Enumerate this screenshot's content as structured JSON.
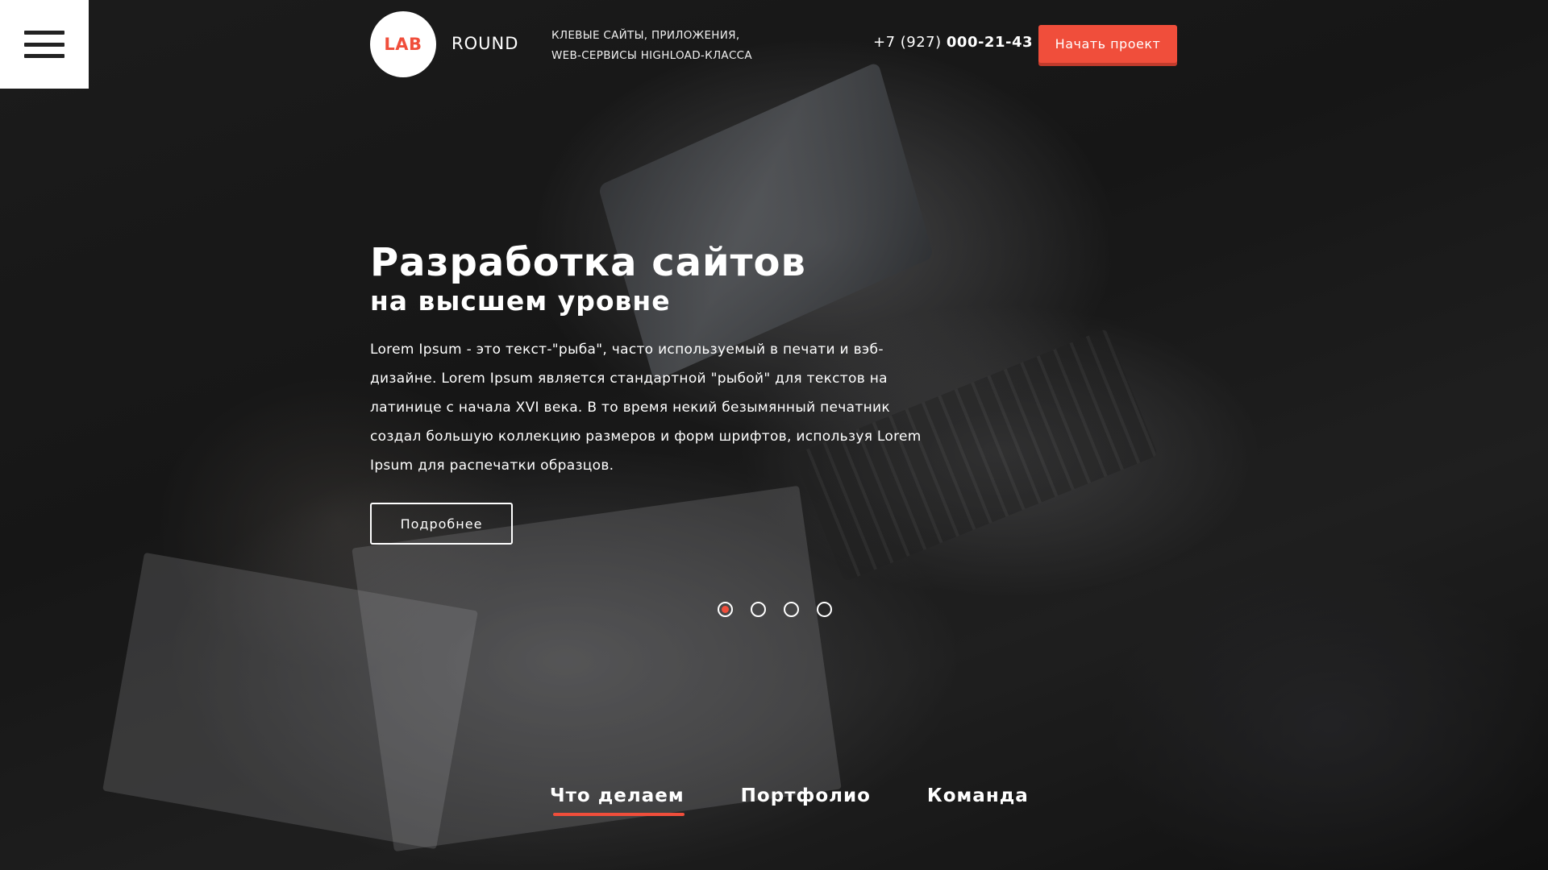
{
  "menu": {
    "icon": "hamburger-menu-icon"
  },
  "header": {
    "logo_lab": "LAB",
    "logo_round": "ROUND",
    "tagline_line1": "КЛЕВЫЕ САЙТЫ, ПРИЛОЖЕНИЯ,",
    "tagline_line2": "WEB-СЕРВИСЫ HIGHLOAD-КЛАССА",
    "phone_code": "+7 (927) ",
    "phone_number": "000-21-43",
    "cta_label": "Начать проект"
  },
  "hero": {
    "title": "Разработка сайтов",
    "subtitle": "на высшем уровне",
    "description": "Lorem Ipsum - это текст-\"рыба\", часто используемый в печати и вэб-дизайне. Lorem Ipsum является стандартной \"рыбой\" для текстов на латинице с начала XVI века. В то время некий безымянный печатник создал большую коллекцию размеров и форм шрифтов, используя Lorem Ipsum для распечатки образцов.",
    "more_label": "Подробнее"
  },
  "slider": {
    "total": 4,
    "active_index": 0
  },
  "bottom_nav": {
    "items": [
      {
        "label": "Что делаем",
        "active": true
      },
      {
        "label": "Портфолио",
        "active": false
      },
      {
        "label": "Команда",
        "active": false
      }
    ]
  },
  "colors": {
    "accent": "#f04e3b",
    "overlay": "#1c1c1c",
    "text": "#ffffff"
  }
}
